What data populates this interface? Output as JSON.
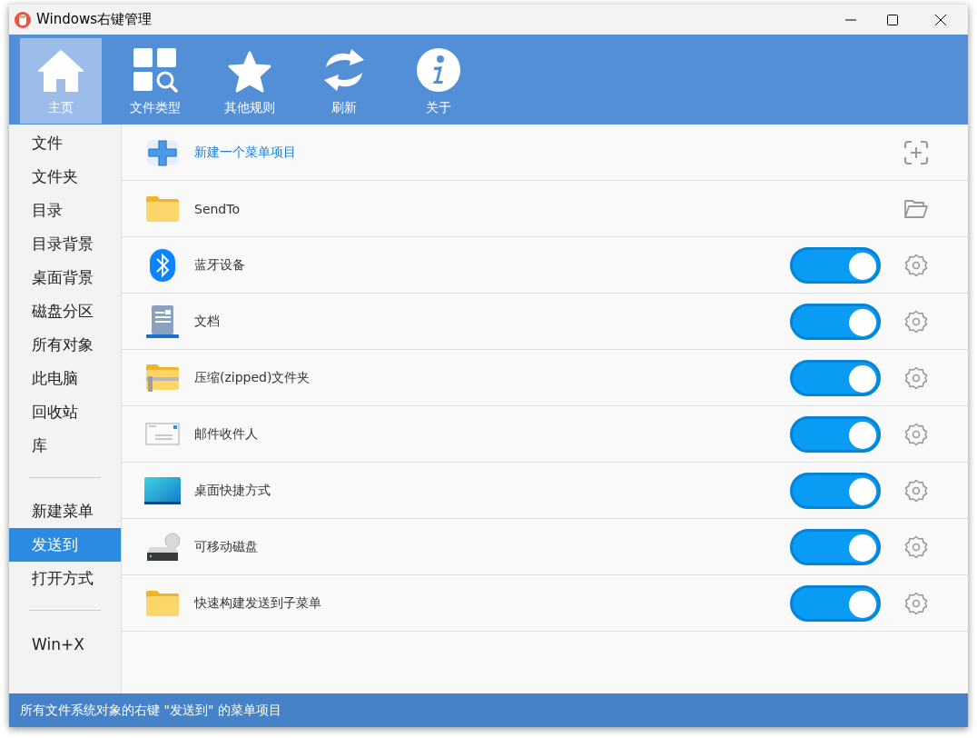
{
  "window": {
    "title": "Windows右键管理"
  },
  "toolbar": [
    {
      "label": "主页",
      "selected": true
    },
    {
      "label": "文件类型",
      "selected": false
    },
    {
      "label": "其他规则",
      "selected": false
    },
    {
      "label": "刷新",
      "selected": false
    },
    {
      "label": "关于",
      "selected": false
    }
  ],
  "sidebar": {
    "groups": [
      [
        {
          "label": "文件",
          "selected": false
        },
        {
          "label": "文件夹",
          "selected": false
        },
        {
          "label": "目录",
          "selected": false
        },
        {
          "label": "目录背景",
          "selected": false
        },
        {
          "label": "桌面背景",
          "selected": false
        },
        {
          "label": "磁盘分区",
          "selected": false
        },
        {
          "label": "所有对象",
          "selected": false
        },
        {
          "label": "此电脑",
          "selected": false
        },
        {
          "label": "回收站",
          "selected": false
        },
        {
          "label": "库",
          "selected": false
        }
      ],
      [
        {
          "label": "新建菜单",
          "selected": false
        },
        {
          "label": "发送到",
          "selected": true
        },
        {
          "label": "打开方式",
          "selected": false
        }
      ],
      [
        {
          "label": "Win+X",
          "selected": false
        }
      ]
    ]
  },
  "rows": [
    {
      "kind": "new",
      "label": "新建一个菜单项目"
    },
    {
      "kind": "folder",
      "label": "SendTo"
    },
    {
      "kind": "toggle",
      "label": "蓝牙设备",
      "on": true
    },
    {
      "kind": "toggle",
      "label": "文档",
      "on": true
    },
    {
      "kind": "toggle",
      "label": "压缩(zipped)文件夹",
      "on": true
    },
    {
      "kind": "toggle",
      "label": "邮件收件人",
      "on": true
    },
    {
      "kind": "toggle",
      "label": "桌面快捷方式",
      "on": true
    },
    {
      "kind": "toggle",
      "label": "可移动磁盘",
      "on": true
    },
    {
      "kind": "toggle",
      "label": "快速构建发送到子菜单",
      "on": true
    }
  ],
  "status_bar": "所有文件系统对象的右键 \"发送到\" 的菜单项目"
}
